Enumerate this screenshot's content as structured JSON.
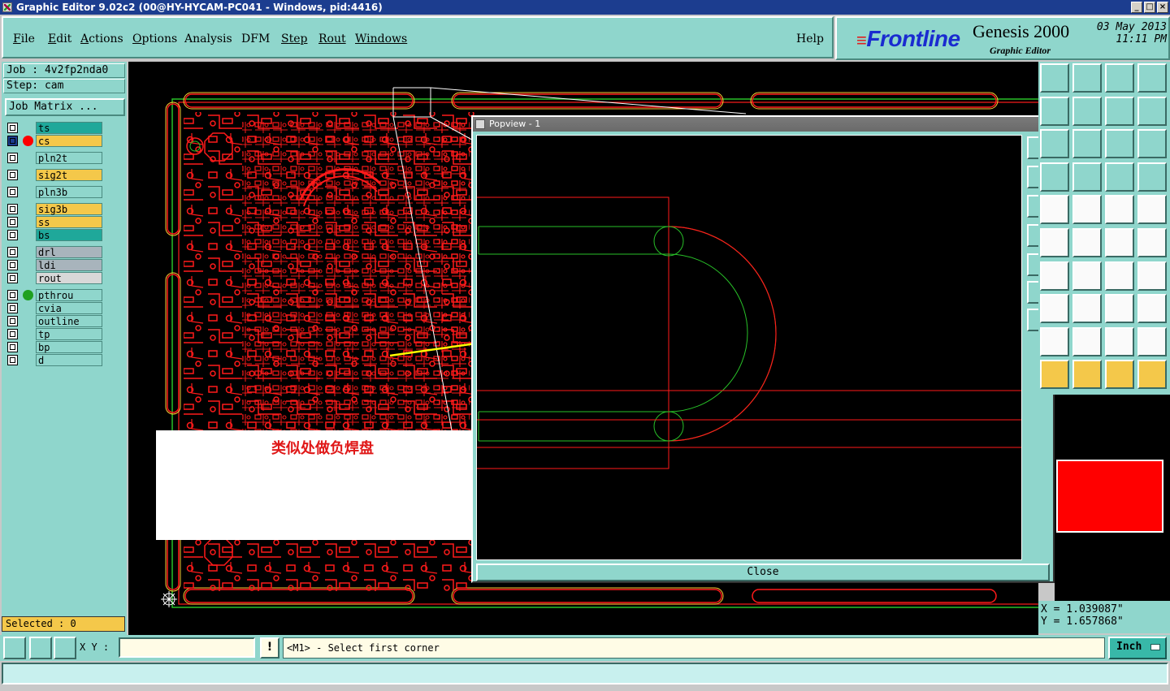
{
  "window": {
    "title": "Graphic Editor 9.02c2 (00@HY-HYCAM-PC041 - Windows, pid:4416)"
  },
  "menu": {
    "items": [
      {
        "key": "F",
        "rest": "ile"
      },
      {
        "key": "E",
        "rest": "dit"
      },
      {
        "key": "A",
        "rest": "ctions"
      },
      {
        "key": "O",
        "rest": "ptions"
      },
      {
        "key": "A",
        "rest": "nalysis"
      },
      {
        "key": "D",
        "rest": "FM"
      },
      {
        "key": "S",
        "rest": "tep"
      },
      {
        "key": "R",
        "rest": "out"
      },
      {
        "key": "W",
        "rest": "indows"
      }
    ],
    "help": "Help"
  },
  "brand": {
    "logo": "Frontline",
    "product": "Genesis 2000",
    "subtitle": "Graphic Editor",
    "date": "03 May 2013",
    "time": "11:11 PM"
  },
  "job": {
    "job_line": "Job : 4v2fp2nda0",
    "step_line": "Step: cam",
    "matrix_label": "Job Matrix ..."
  },
  "layers": [
    {
      "name": "ts",
      "color": "#1fa89a",
      "dot": ""
    },
    {
      "name": "cs",
      "color": "#f4c84a",
      "dot": "#ff0000",
      "active": true
    },
    {
      "name": "pln2t",
      "color": "#8fd6cc",
      "dot": ""
    },
    {
      "name": "sig2t",
      "color": "#f4c84a",
      "dot": ""
    },
    {
      "name": "pln3b",
      "color": "#8fd6cc",
      "dot": ""
    },
    {
      "name": "sig3b",
      "color": "#f4c84a",
      "dot": ""
    },
    {
      "name": "ss",
      "color": "#f4c84a",
      "dot": ""
    },
    {
      "name": "bs",
      "color": "#1fa89a",
      "dot": ""
    },
    {
      "name": "drl",
      "color": "#a8b4bc",
      "dot": ""
    },
    {
      "name": "ldi",
      "color": "#a8b4bc",
      "dot": ""
    },
    {
      "name": "rout",
      "color": "#d8d8d8",
      "dot": ""
    },
    {
      "name": "pthrou",
      "color": "#8fd6cc",
      "dot": "#20a020"
    },
    {
      "name": "cvia",
      "color": "#8fd6cc",
      "dot": ""
    },
    {
      "name": "outline",
      "color": "#8fd6cc",
      "dot": ""
    },
    {
      "name": "tp",
      "color": "#8fd6cc",
      "dot": ""
    },
    {
      "name": "bp",
      "color": "#8fd6cc",
      "dot": ""
    },
    {
      "name": "d",
      "color": "#8fd6cc",
      "dot": ""
    }
  ],
  "selected_label": "Selected : 0",
  "annotation": {
    "text": "类似处做负焊盘"
  },
  "popview": {
    "title": "Popview - 1",
    "close_label": "Close",
    "close_x": "x"
  },
  "coords": {
    "x": "X = 1.039087\"",
    "y": "Y = 1.657868\""
  },
  "bottom": {
    "xy_label": "X Y :",
    "xy_value": "",
    "warn": "!",
    "prompt": "<M1> - Select first corner",
    "unit": "Inch"
  },
  "colors": {
    "board_trace": "#ff1a1a",
    "outline_green": "#28c028",
    "accent_teal": "#8fd6cc",
    "highlight_yellow": "#f4c84a"
  }
}
